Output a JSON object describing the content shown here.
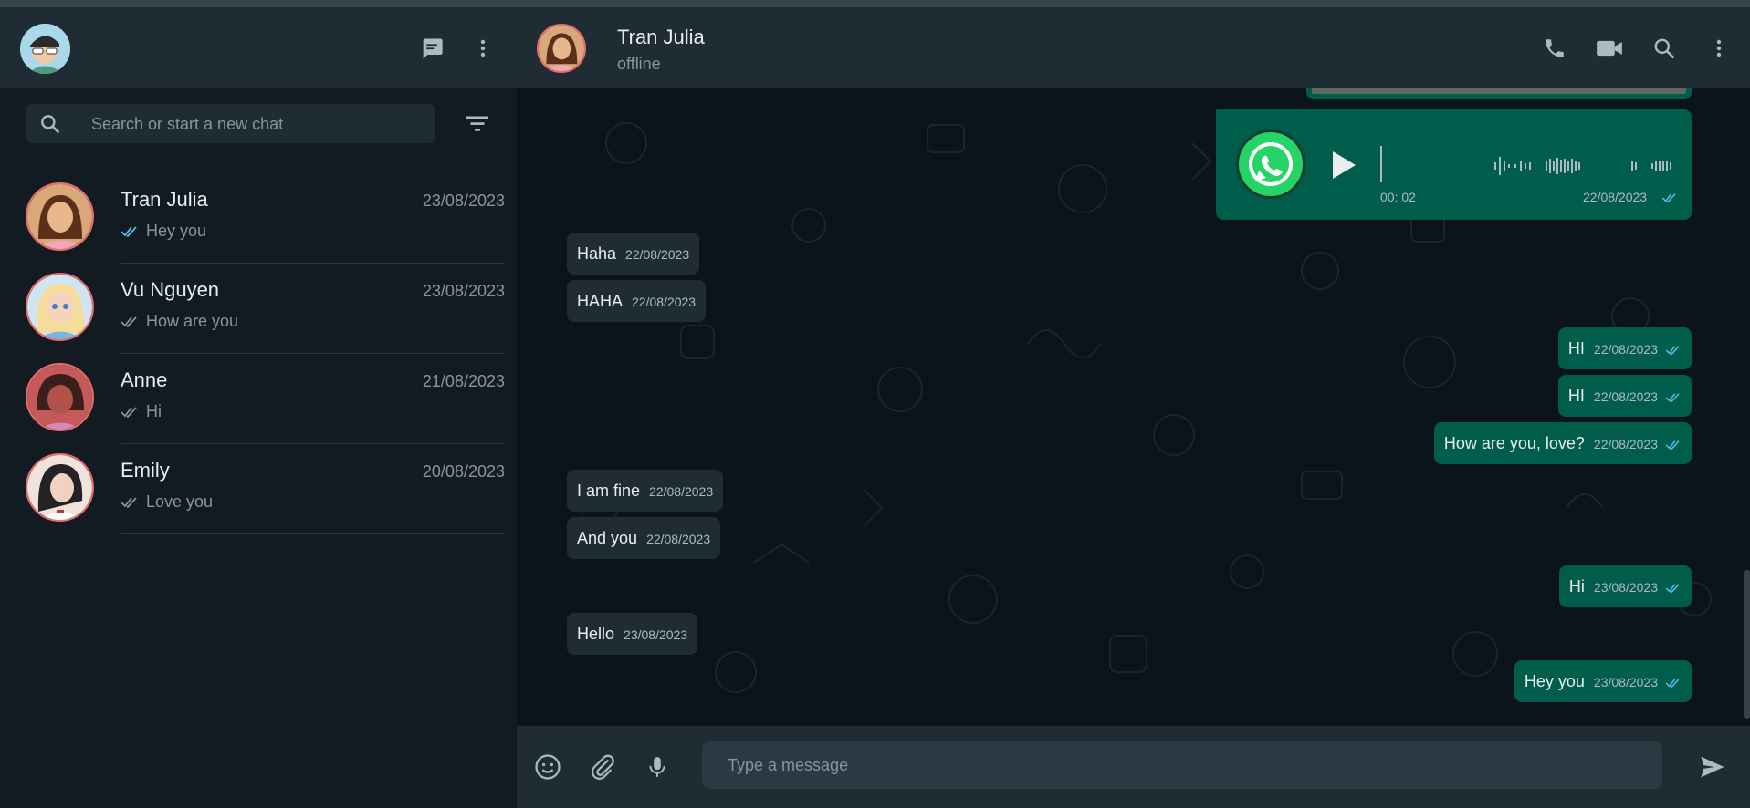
{
  "sidebar": {
    "search_placeholder": "Search or start a new chat",
    "chats": [
      {
        "name": "Tran Julia",
        "date": "23/08/2023",
        "preview": "Hey you",
        "read": true
      },
      {
        "name": "Vu Nguyen",
        "date": "23/08/2023",
        "preview": "How are you",
        "read": false
      },
      {
        "name": "Anne",
        "date": "21/08/2023",
        "preview": "Hi",
        "read": false
      },
      {
        "name": "Emily",
        "date": "20/08/2023",
        "preview": "Love you",
        "read": false
      }
    ]
  },
  "chat": {
    "contact_name": "Tran Julia",
    "status": "offline",
    "voice_message": {
      "duration": "00: 02",
      "time": "22/08/2023"
    },
    "messages": [
      {
        "text": "Haha",
        "time": "22/08/2023",
        "dir": "in"
      },
      {
        "text": "HAHA",
        "time": "22/08/2023",
        "dir": "in"
      },
      {
        "text": "HI",
        "time": "22/08/2023",
        "dir": "out"
      },
      {
        "text": "HI",
        "time": "22/08/2023",
        "dir": "out"
      },
      {
        "text": "How are you, love?",
        "time": "22/08/2023",
        "dir": "out"
      },
      {
        "text": "I am fine",
        "time": "22/08/2023",
        "dir": "in"
      },
      {
        "text": "And you",
        "time": "22/08/2023",
        "dir": "in"
      },
      {
        "text": "Hi",
        "time": "23/08/2023",
        "dir": "out"
      },
      {
        "text": "Hello",
        "time": "23/08/2023",
        "dir": "in"
      },
      {
        "text": "Hey you",
        "time": "23/08/2023",
        "dir": "out"
      }
    ]
  },
  "composer": {
    "placeholder": "Type a message"
  },
  "colors": {
    "accent": "#005c4b",
    "read_tick": "#53bdeb",
    "panel": "#202c33",
    "background": "#111b21"
  },
  "icons": [
    "new-chat-icon",
    "menu-icon",
    "search-icon",
    "filter-icon",
    "phone-icon",
    "video-icon",
    "emoji-icon",
    "attach-icon",
    "mic-icon",
    "send-icon",
    "play-icon",
    "whatsapp-icon",
    "double-check-icon"
  ]
}
